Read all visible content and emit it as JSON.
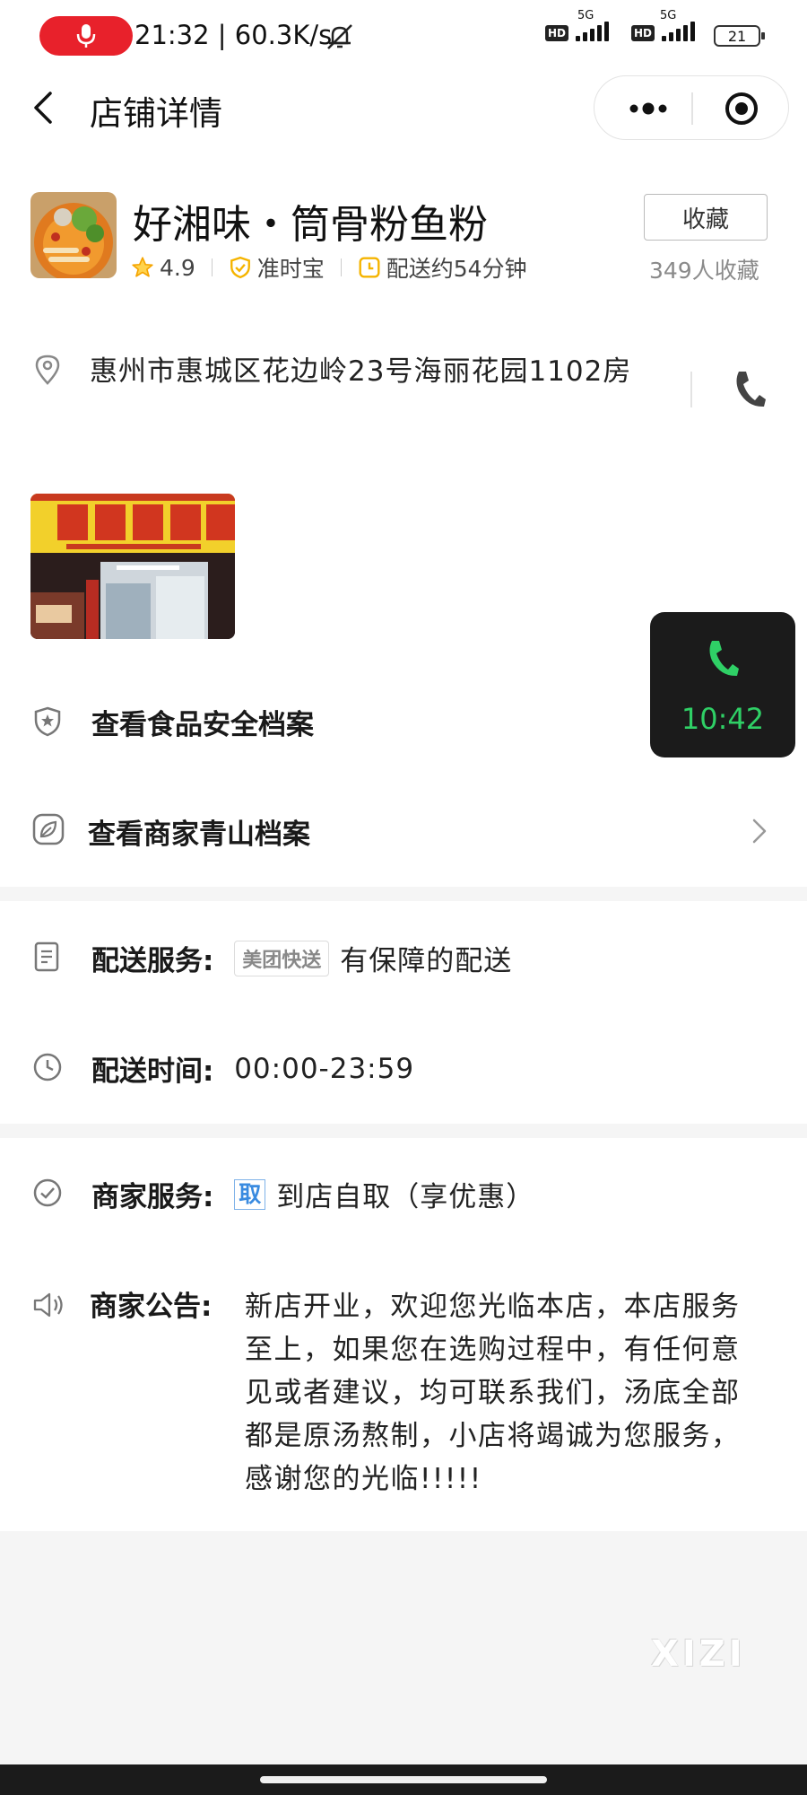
{
  "status_bar": {
    "time_speed": "21:32 | 60.3K/s",
    "hd_label": "HD",
    "net_label": "5G",
    "battery": "21"
  },
  "nav": {
    "title": "店铺详情"
  },
  "shop": {
    "name": "好湘味・筒骨粉鱼粉",
    "rating": "4.9",
    "badge": "准时宝",
    "delivery_time": "配送约54分钟",
    "favorite_label": "收藏",
    "favorite_count": "349人收藏"
  },
  "address": {
    "text": "惠州市惠城区花边岭23号海丽花园1102房"
  },
  "call_widget": {
    "duration": "10:42"
  },
  "links": {
    "food_safety": "查看食品安全档案",
    "green_archive": "查看商家青山档案"
  },
  "delivery_service": {
    "label": "配送服务:",
    "tag": "美团快送",
    "value": "有保障的配送"
  },
  "delivery_hours": {
    "label": "配送时间:",
    "value": "00:00-23:59"
  },
  "merchant_service": {
    "label": "商家服务:",
    "tag": "取",
    "value": "到店自取（享优惠）"
  },
  "announcement": {
    "label": "商家公告:",
    "text": "新店开业，欢迎您光临本店，本店服务至上，如果您在选购过程中，有任何意见或者建议，均可联系我们，汤底全部都是原汤熬制，小店将竭诚为您服务，感谢您的光临!!!!!"
  },
  "watermark": "XIZI",
  "colors": {
    "accent_green": "#2fd066",
    "badge_yellow": "#f5b400",
    "record_red": "#e8212b",
    "tag_blue": "#3a8be0"
  }
}
